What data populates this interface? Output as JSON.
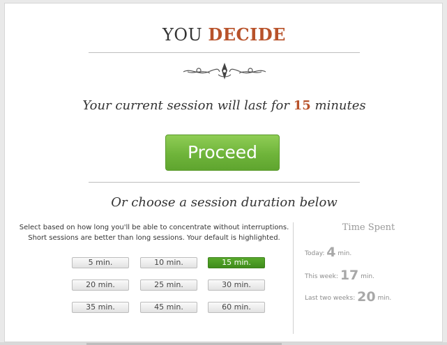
{
  "header": {
    "title_plain": "YOU",
    "title_accent": "DECIDE"
  },
  "session": {
    "prefix": "Your current session will last for",
    "minutes": "15",
    "suffix": "minutes"
  },
  "proceed_label": "Proceed",
  "choose_heading": "Or choose a session duration below",
  "instructions": {
    "line1": "Select based on how long you'll be able to concentrate without interruptions.",
    "line2": "Short sessions are better than long sessions. Your default is highlighted."
  },
  "durations": [
    {
      "label": "5 min.",
      "selected": false
    },
    {
      "label": "10 min.",
      "selected": false
    },
    {
      "label": "15 min.",
      "selected": true
    },
    {
      "label": "20 min.",
      "selected": false
    },
    {
      "label": "25 min.",
      "selected": false
    },
    {
      "label": "30 min.",
      "selected": false
    },
    {
      "label": "35 min.",
      "selected": false
    },
    {
      "label": "45 min.",
      "selected": false
    },
    {
      "label": "60 min.",
      "selected": false
    }
  ],
  "time_spent": {
    "title": "Time Spent",
    "today": {
      "label": "Today:",
      "value": "4",
      "unit": "min."
    },
    "week": {
      "label": "This week:",
      "value": "17",
      "unit": "min."
    },
    "two_weeks": {
      "label": "Last two weeks:",
      "value": "20",
      "unit": "min."
    }
  },
  "colors": {
    "accent": "#b8522a",
    "proceed_green": "#6fb43a",
    "selected_green": "#4a9a24"
  }
}
